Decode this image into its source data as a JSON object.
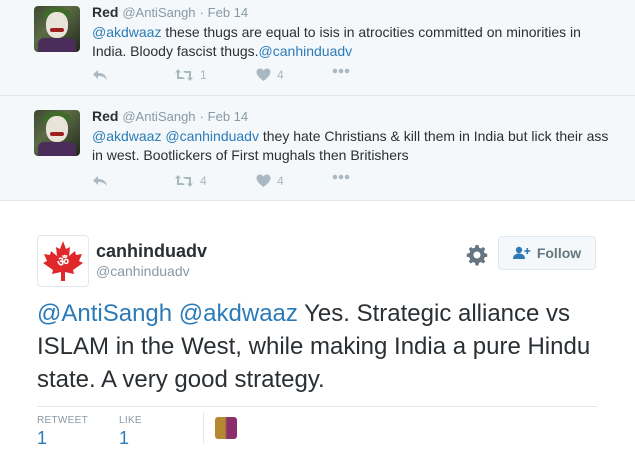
{
  "tweets": [
    {
      "name": "Red",
      "handle": "@AntiSangh",
      "separator": "·",
      "date": "Feb 14",
      "text_mention": "@akdwaaz",
      "text_body": " these thugs are equal to isis in atrocities committed on minorities in India. Bloody fascist thugs.",
      "text_trailing_link": "@canhinduadv",
      "retweets": "1",
      "likes": "4"
    },
    {
      "name": "Red",
      "handle": "@AntiSangh",
      "separator": "·",
      "date": "Feb 14",
      "text_mention": "@akdwaaz",
      "text_mention2": "@canhinduadv",
      "text_body": " they hate Christians & kill them in India but lick their ass in west. Bootlickers of First mughals then Britishers",
      "retweets": "4",
      "likes": "4"
    }
  ],
  "main_tweet": {
    "name": "canhinduadv",
    "handle": "@canhinduadv",
    "follow_label": "Follow",
    "mention1": "@AntiSangh",
    "mention2": "@akdwaaz",
    "text_body": " Yes. Strategic alliance vs ISLAM in the West, while making India a pure Hindu state. A very good strategy.",
    "retweet_label": "RETWEET",
    "retweet_count": "1",
    "like_label": "LIKE",
    "like_count": "1"
  },
  "colors": {
    "link": "#2b7bb9",
    "reply_bg": "#f5f8fa",
    "muted": "#8899a6",
    "maple": "#e0282c"
  },
  "icons": [
    "reply-icon",
    "retweet-icon",
    "heart-icon",
    "more-icon",
    "gear-icon",
    "follow-user-icon",
    "maple-leaf-om-icon"
  ]
}
